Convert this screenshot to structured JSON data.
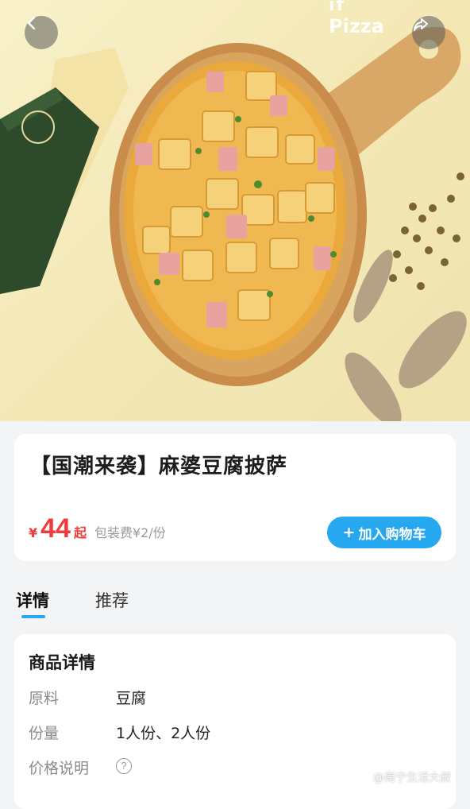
{
  "hero": {
    "brand_line1": "if",
    "brand_line2": "Pizza",
    "back_icon": "chevron-left-icon",
    "share_icon": "share-icon"
  },
  "product": {
    "name": "【国潮来袭】麻婆豆腐披萨",
    "currency_symbol": "¥",
    "price": "44",
    "price_suffix": "起",
    "packing_fee": "包装费¥2/份",
    "add_to_cart_plus": "+",
    "add_to_cart_label": "加入购物车"
  },
  "tabs": [
    {
      "label": "详情",
      "active": true
    },
    {
      "label": "推荐",
      "active": false
    }
  ],
  "details": {
    "heading": "商品详情",
    "rows": [
      {
        "label": "原料",
        "value": "豆腐"
      },
      {
        "label": "份量",
        "value": "1人份、2人份"
      },
      {
        "label": "价格说明",
        "value": "?"
      }
    ]
  },
  "watermark": "@南宁生活大叔",
  "colors": {
    "accent": "#25a8ef",
    "price": "#ef3b3b",
    "background": "#f3f4f6"
  }
}
